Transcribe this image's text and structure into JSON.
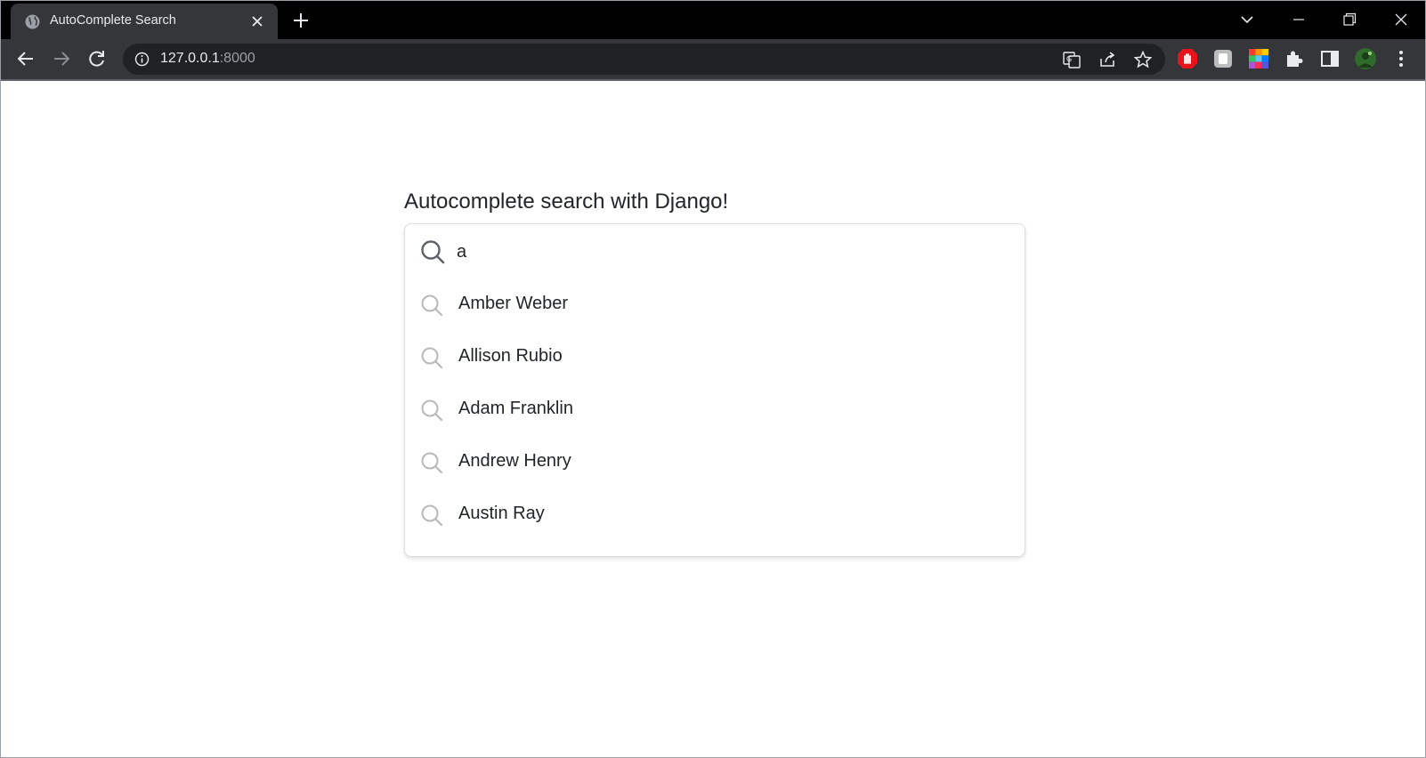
{
  "browser": {
    "tab_title": "AutoComplete Search",
    "url_host": "127.0.0.1",
    "url_port": ":8000"
  },
  "page": {
    "title": "Autocomplete search with Django!",
    "search": {
      "value": "a",
      "placeholder": ""
    },
    "suggestions": [
      {
        "label": "Amber Weber"
      },
      {
        "label": "Allison Rubio"
      },
      {
        "label": "Adam Franklin"
      },
      {
        "label": "Andrew Henry"
      },
      {
        "label": "Austin Ray"
      }
    ]
  },
  "colors": {
    "tab_strip": "#000000",
    "toolbar": "#35363a",
    "omnibox": "#202124",
    "page_bg": "#ffffff",
    "text": "#212529"
  }
}
